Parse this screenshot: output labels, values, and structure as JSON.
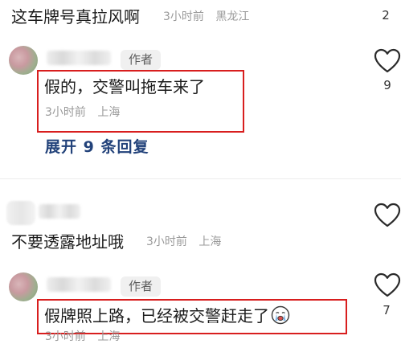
{
  "comments": [
    {
      "text": "这车牌号真拉风啊",
      "time": "3小时前",
      "location": "黑龙江",
      "likes": "2"
    },
    {
      "author_badge": "作者",
      "text": "假的，交警叫拖车来了",
      "time": "3小时前",
      "location": "上海",
      "likes": "9",
      "expand_label": "展开 9 条回复"
    },
    {
      "text": "不要透露地址哦",
      "time": "3小时前",
      "location": "上海"
    },
    {
      "author_badge": "作者",
      "text": "假牌照上路，已经被交警赶走了",
      "time": "3小时前",
      "location": "上海",
      "likes": "7"
    }
  ],
  "colors": {
    "highlight_border": "#d81e1e",
    "expand_link": "#22427a",
    "meta_text": "#9a9a9a"
  },
  "icons": [
    "heart-outline-icon",
    "crying-emoji-icon"
  ]
}
